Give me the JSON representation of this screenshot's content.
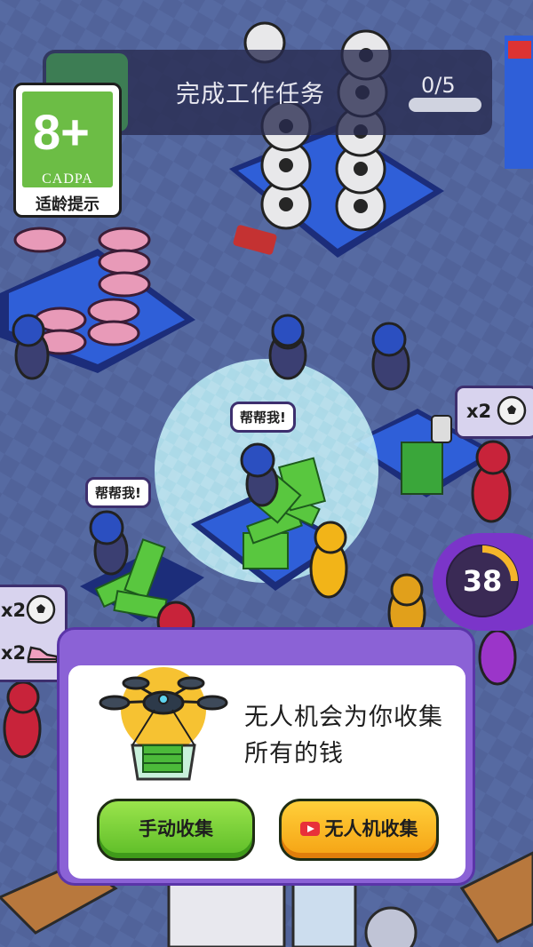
{
  "task": {
    "title": "完成工作任务",
    "progress_text": "0/5",
    "progress_fraction": 0
  },
  "rating": {
    "age": "8+",
    "org": "CADPA",
    "label": "适龄提示"
  },
  "speech": {
    "help_1": "帮帮我!",
    "help_2": "帮帮我!"
  },
  "bubbles": {
    "right": {
      "multiplier": "x2",
      "icon": "soccer-ball-icon"
    },
    "left": [
      {
        "multiplier": "x2",
        "icon": "soccer-ball-icon"
      },
      {
        "multiplier": "x2",
        "icon": "sneaker-icon"
      }
    ]
  },
  "timer": {
    "value": "38"
  },
  "dialog": {
    "message": "无人机会为你收集所有的钱",
    "manual_button": "手动收集",
    "drone_button": "无人机收集",
    "drone_button_icon": "video-ad-icon"
  },
  "colors": {
    "dialog_frame": "#8b62d6",
    "manual_button": "#6cc82f",
    "drone_button": "#f8b21f",
    "rating_green": "#6cbd45",
    "timer": "#7b35c9"
  }
}
